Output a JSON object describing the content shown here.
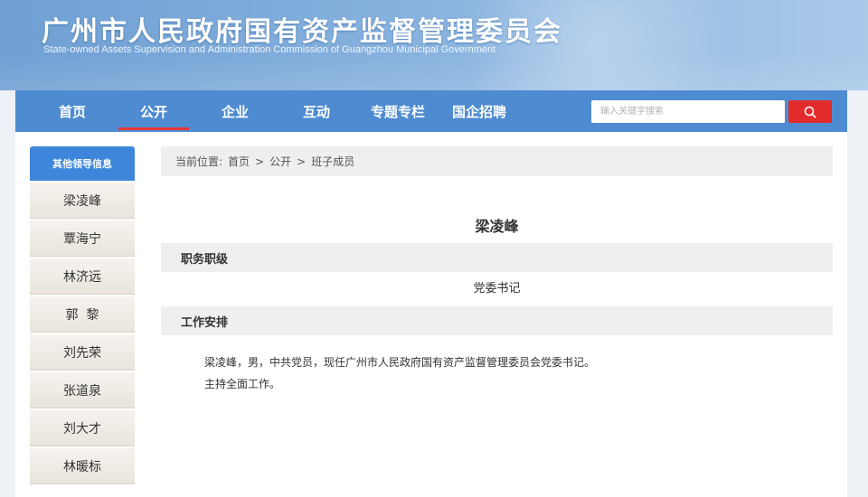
{
  "header": {
    "title": "广州市人民政府国有资产监督管理委员会",
    "subtitle": "State-owned  Assets Supervision and Administration Commission of Guangzhou Municipal Government"
  },
  "nav": {
    "items": [
      {
        "label": "首页"
      },
      {
        "label": "公开"
      },
      {
        "label": "企业"
      },
      {
        "label": "互动"
      },
      {
        "label": "专题专栏"
      },
      {
        "label": "国企招聘"
      }
    ],
    "active": "公开"
  },
  "search": {
    "placeholder": "输入关键字搜索",
    "icon": "search-icon"
  },
  "sidebar": {
    "header": "其他领导信息",
    "items": [
      {
        "label": "梁凌峰"
      },
      {
        "label": "覃海宁"
      },
      {
        "label": "林济远"
      },
      {
        "label": "郭  黎"
      },
      {
        "label": "刘先荣"
      },
      {
        "label": "张道泉"
      },
      {
        "label": "刘大才"
      },
      {
        "label": "林暖标"
      }
    ]
  },
  "breadcrumb": {
    "prefix": "当前位置:",
    "items": [
      "首页",
      "公开",
      "班子成员"
    ],
    "separator": ">"
  },
  "leader": {
    "name": "梁凌峰",
    "position_heading": "职务职级",
    "position": "党委书记",
    "work_heading": "工作安排",
    "bio": "梁凌峰，男，中共党员，现任广州市人民政府国有资产监督管理委员会党委书记。",
    "duty": "主持全面工作。"
  },
  "colors": {
    "nav_bg": "#4e8bd0",
    "active_underline": "#e53935",
    "search_button": "#e32b2b",
    "sidebar_header": "#3e86db"
  }
}
